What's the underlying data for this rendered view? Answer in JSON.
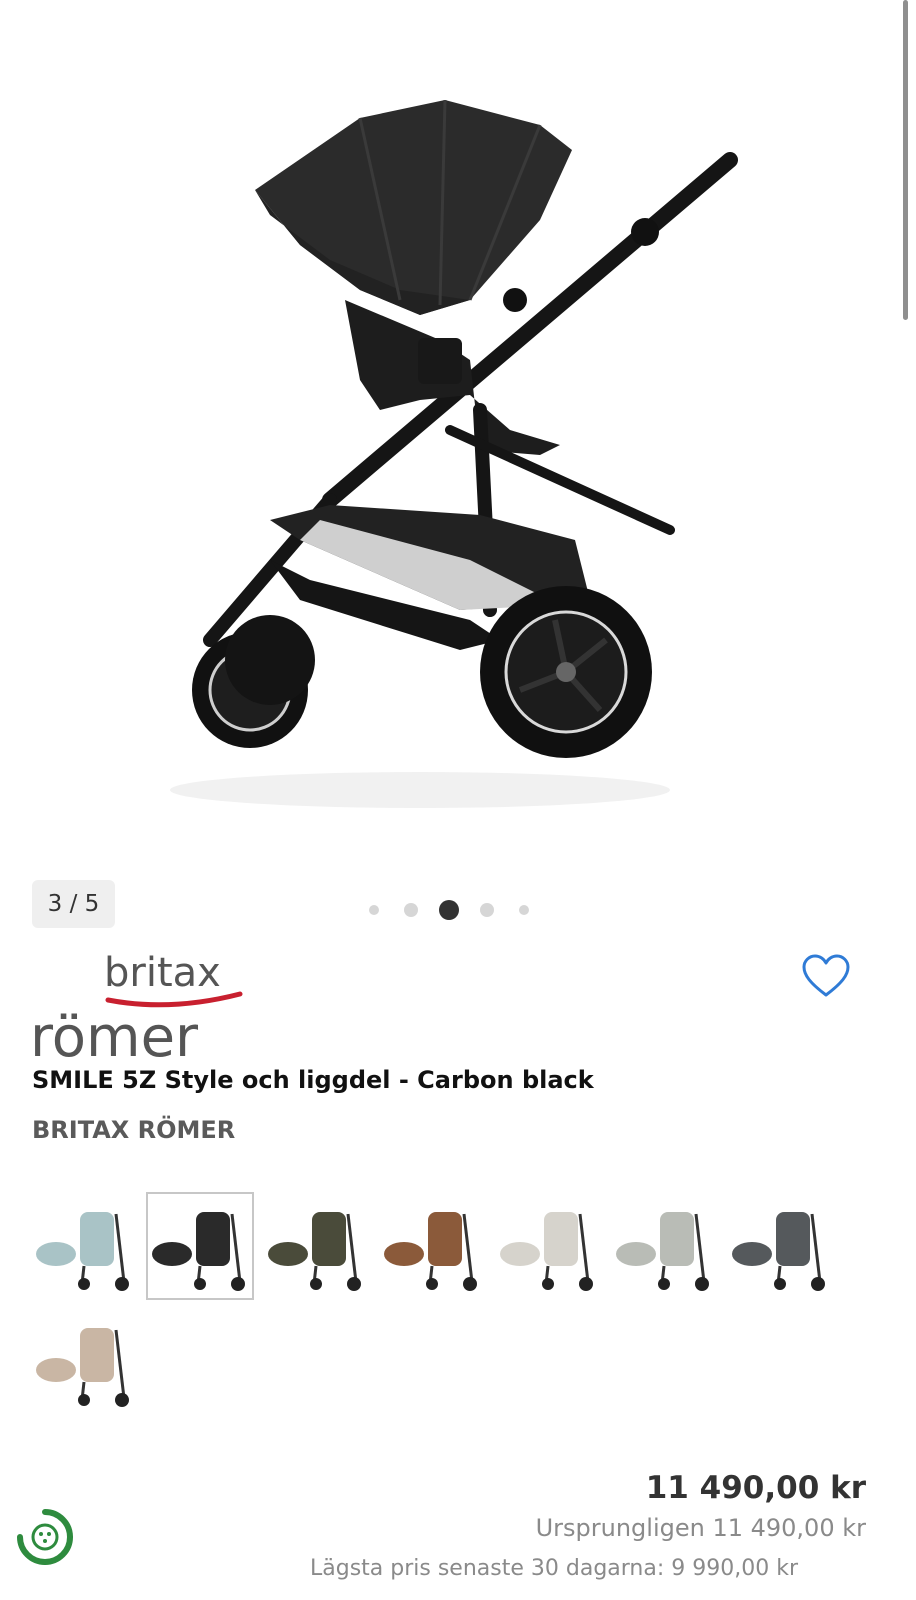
{
  "gallery": {
    "counter": "3 / 5",
    "total_images": 5,
    "active_index": 3
  },
  "product": {
    "logo_text_top": "britax",
    "logo_text_bottom": "römer",
    "title": "SMILE 5Z Style och liggdel - Carbon black",
    "brand": "BRITAX RÖMER",
    "favorite_icon": "heart-icon"
  },
  "variants": [
    {
      "color": "#a9c3c6"
    },
    {
      "color": "#2a2a2a",
      "selected": true
    },
    {
      "color": "#4a4b3a"
    },
    {
      "color": "#8b5a3a"
    },
    {
      "color": "#d6d3cc"
    },
    {
      "color": "#b9bcb6"
    },
    {
      "color": "#55595c"
    },
    {
      "color": "#c9b6a4"
    }
  ],
  "pricing": {
    "price": "11 490,00 kr",
    "original_price": "Ursprungligen 11 490,00 kr",
    "lowest_price": "Lägsta pris senaste 30 dagarna: 9 990,00 kr"
  },
  "colors": {
    "heart": "#2f7bd6",
    "eco": "#2e8b3e"
  }
}
